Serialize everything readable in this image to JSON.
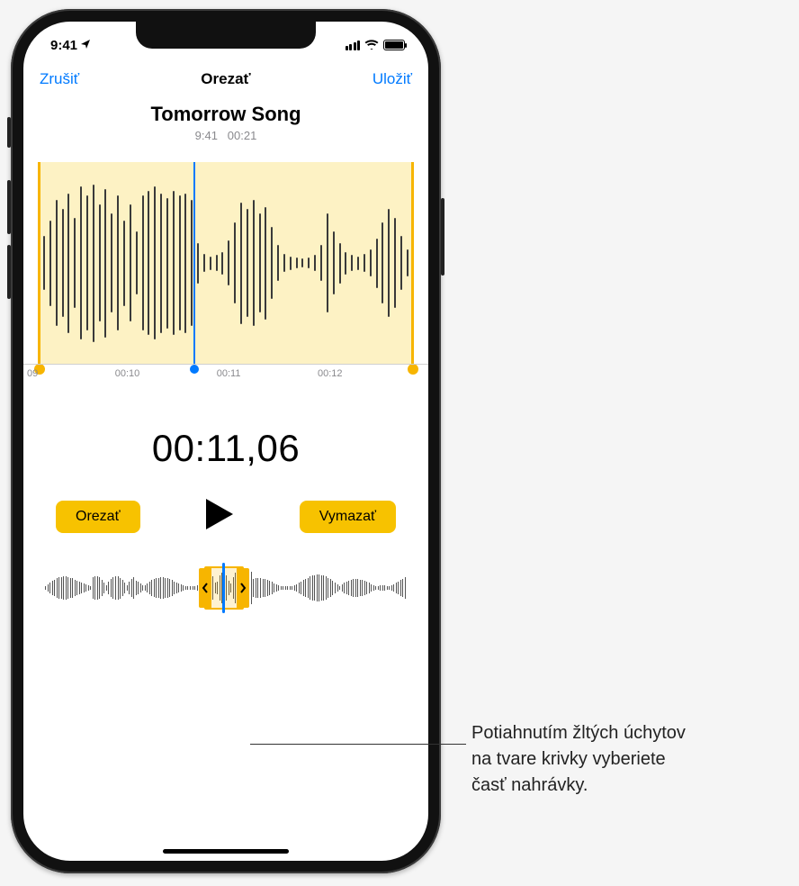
{
  "status": {
    "time": "9:41"
  },
  "nav": {
    "cancel": "Zrušiť",
    "title": "Orezať",
    "save": "Uložiť"
  },
  "recording": {
    "title": "Tomorrow Song",
    "time_created": "9:41",
    "duration": "00:21"
  },
  "timeline": {
    "t0": "09",
    "t1": "00:10",
    "t2": "00:11",
    "t3": "00:12"
  },
  "position": "00:11,06",
  "controls": {
    "trim": "Orezať",
    "delete": "Vymazať"
  },
  "callout": {
    "line1": "Potiahnutím žltých úchytov",
    "line2": "na tvare krivky vyberiete",
    "line3": "časť nahrávky."
  }
}
